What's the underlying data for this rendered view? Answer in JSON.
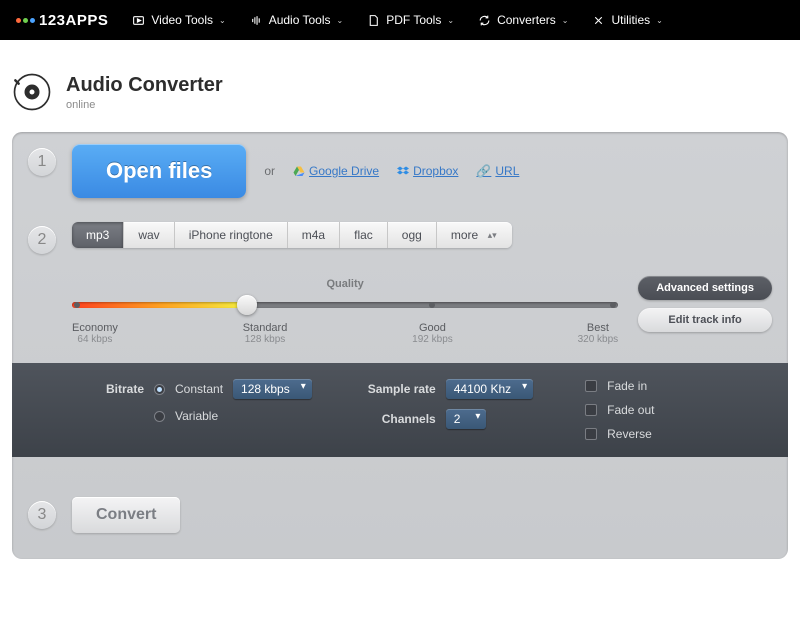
{
  "brand": "123APPS",
  "nav": [
    {
      "label": "Video Tools"
    },
    {
      "label": "Audio Tools"
    },
    {
      "label": "PDF Tools"
    },
    {
      "label": "Converters"
    },
    {
      "label": "Utilities"
    }
  ],
  "page": {
    "title": "Audio Converter",
    "subtitle": "online"
  },
  "step1": {
    "open": "Open files",
    "or": "or",
    "googleDrive": "Google Drive",
    "dropbox": "Dropbox",
    "url": "URL"
  },
  "step2": {
    "formats": [
      "mp3",
      "wav",
      "iPhone ringtone",
      "m4a",
      "flac",
      "ogg",
      "more"
    ],
    "activeFormat": "mp3",
    "qualityTitle": "Quality",
    "qualityStops": [
      {
        "name": "Economy",
        "rate": "64 kbps"
      },
      {
        "name": "Standard",
        "rate": "128 kbps"
      },
      {
        "name": "Good",
        "rate": "192 kbps"
      },
      {
        "name": "Best",
        "rate": "320 kbps"
      }
    ],
    "advancedBtn": "Advanced settings",
    "editTrackBtn": "Edit track info"
  },
  "advanced": {
    "bitrateLabel": "Bitrate",
    "bitrateConstant": "Constant",
    "bitrateVariable": "Variable",
    "bitrateSelected": "128 kbps",
    "sampleRateLabel": "Sample rate",
    "sampleRateSelected": "44100 Khz",
    "channelsLabel": "Channels",
    "channelsSelected": "2",
    "fadeIn": "Fade in",
    "fadeOut": "Fade out",
    "reverse": "Reverse"
  },
  "step3": {
    "convert": "Convert"
  }
}
